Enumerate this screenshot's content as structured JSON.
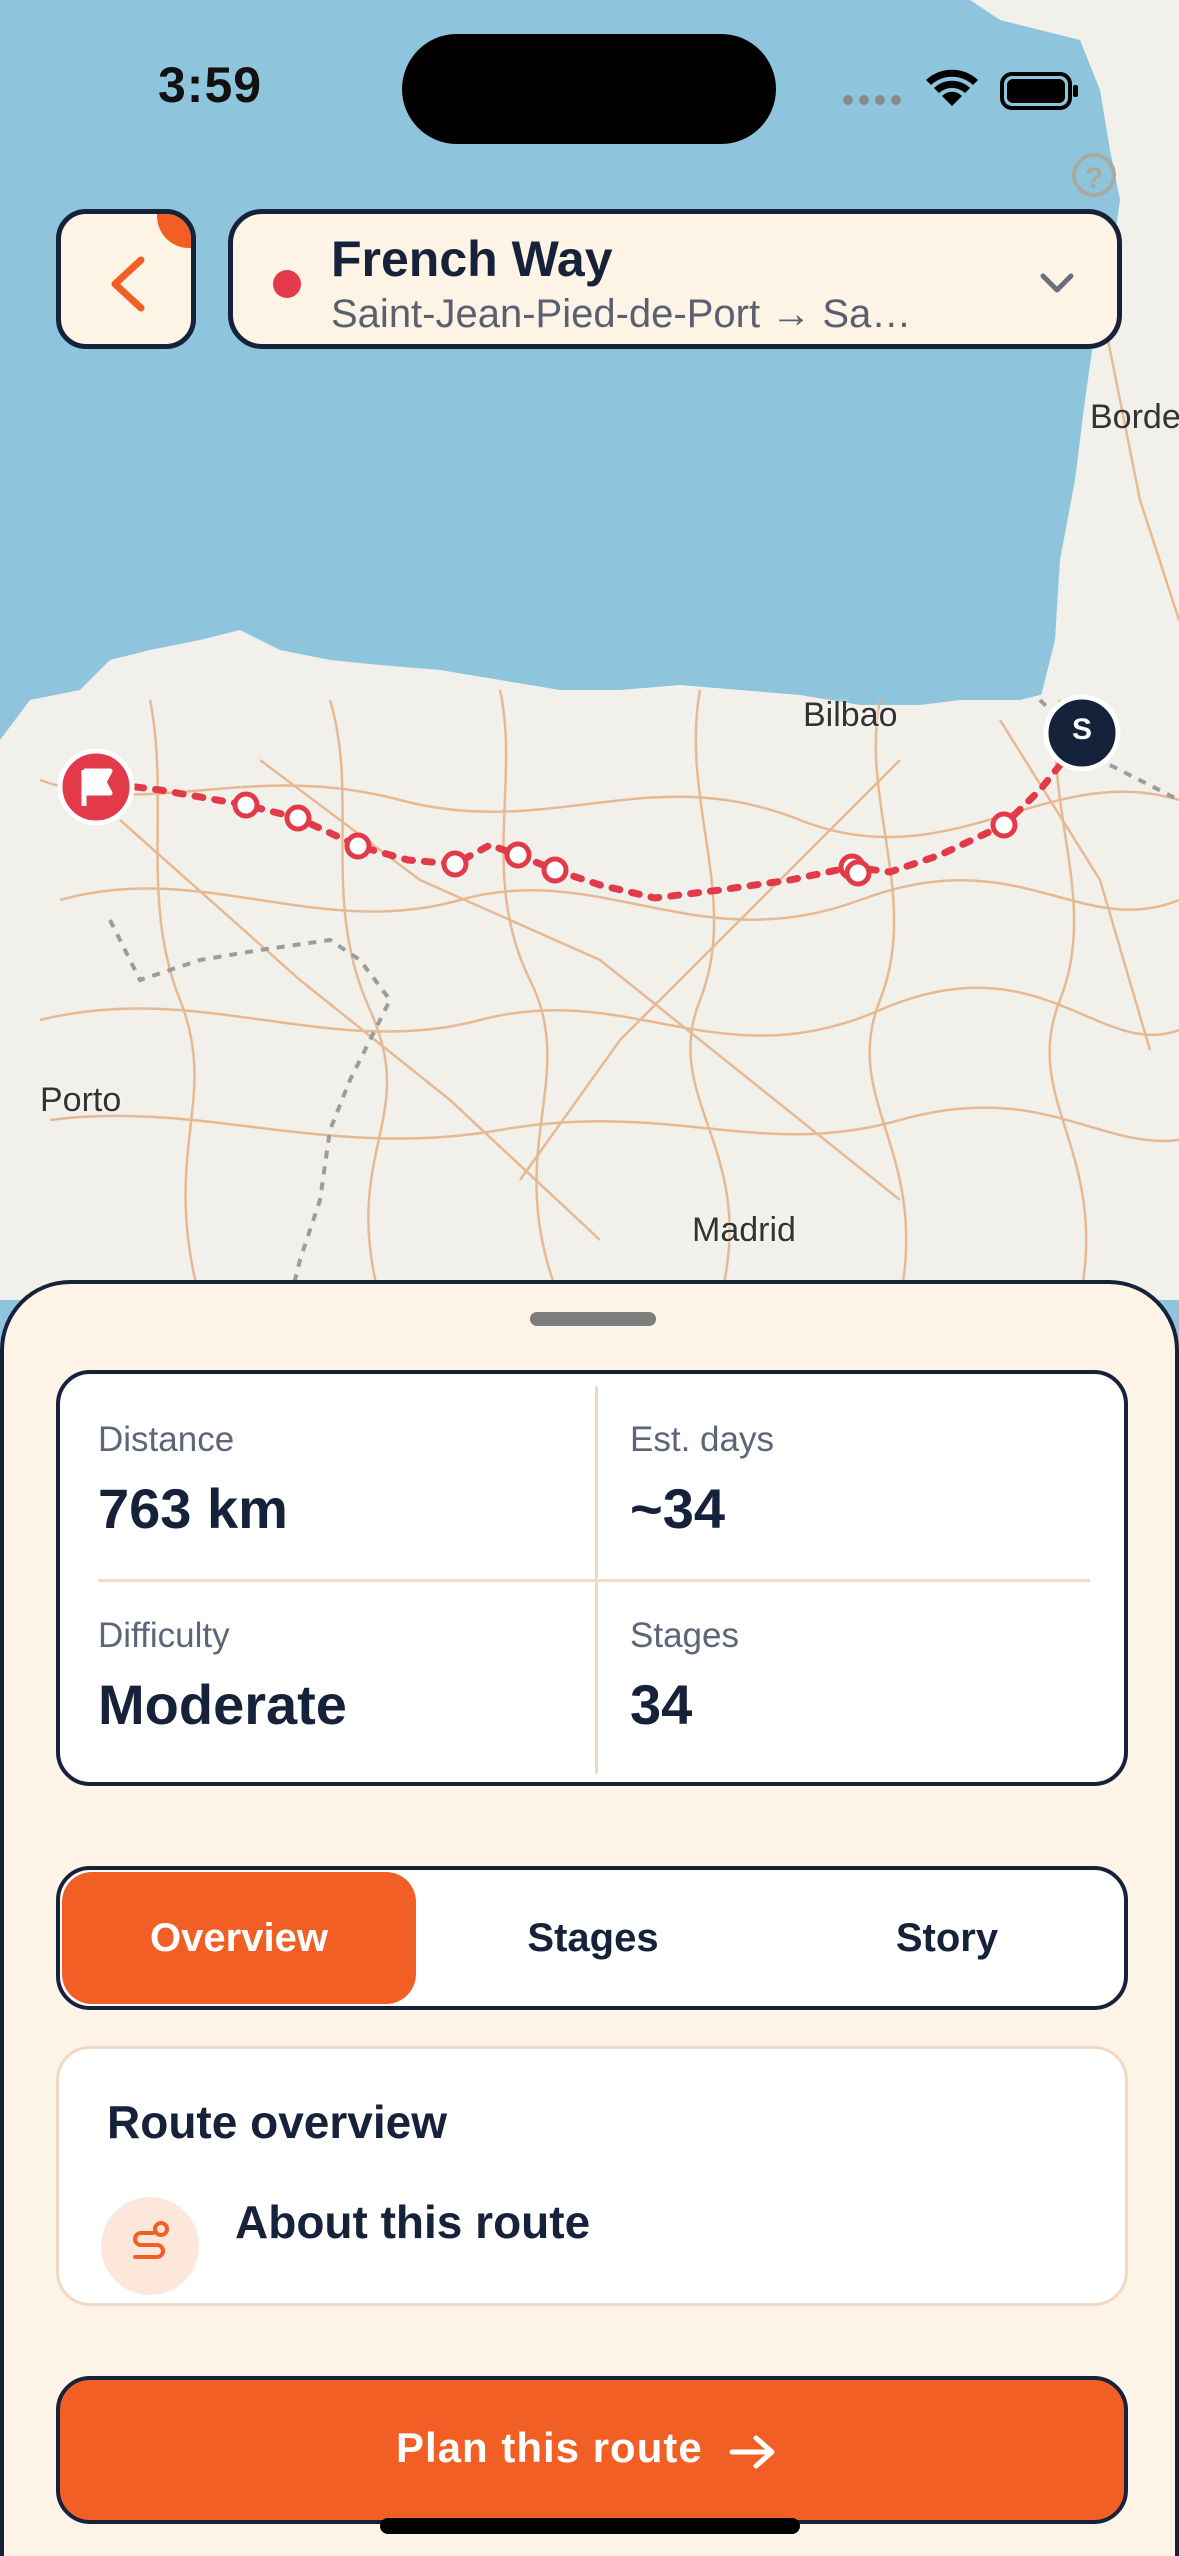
{
  "status": {
    "time": "3:59"
  },
  "header": {
    "route_name": "French Way",
    "route_path": "Saint-Jean-Pied-de-Port → Sa…"
  },
  "map": {
    "labels": {
      "bordeaux": "Borde",
      "bilbao": "Bilbao",
      "porto": "Porto",
      "madrid": "Madrid"
    },
    "start_marker": "S"
  },
  "stats": {
    "distance_label": "Distance",
    "distance_value": "763 km",
    "days_label": "Est. days",
    "days_value": "~34",
    "difficulty_label": "Difficulty",
    "difficulty_value": "Moderate",
    "stages_label": "Stages",
    "stages_value": "34"
  },
  "tabs": [
    {
      "label": "Overview",
      "active": true
    },
    {
      "label": "Stages",
      "active": false
    },
    {
      "label": "Story",
      "active": false
    }
  ],
  "overview": {
    "title": "Route overview",
    "about_title": "About this route"
  },
  "cta": {
    "label": "Plan this route"
  },
  "colors": {
    "accent": "#f25f24",
    "navy": "#16213a",
    "route": "#e23a48",
    "sheet": "#fdf4e7"
  }
}
